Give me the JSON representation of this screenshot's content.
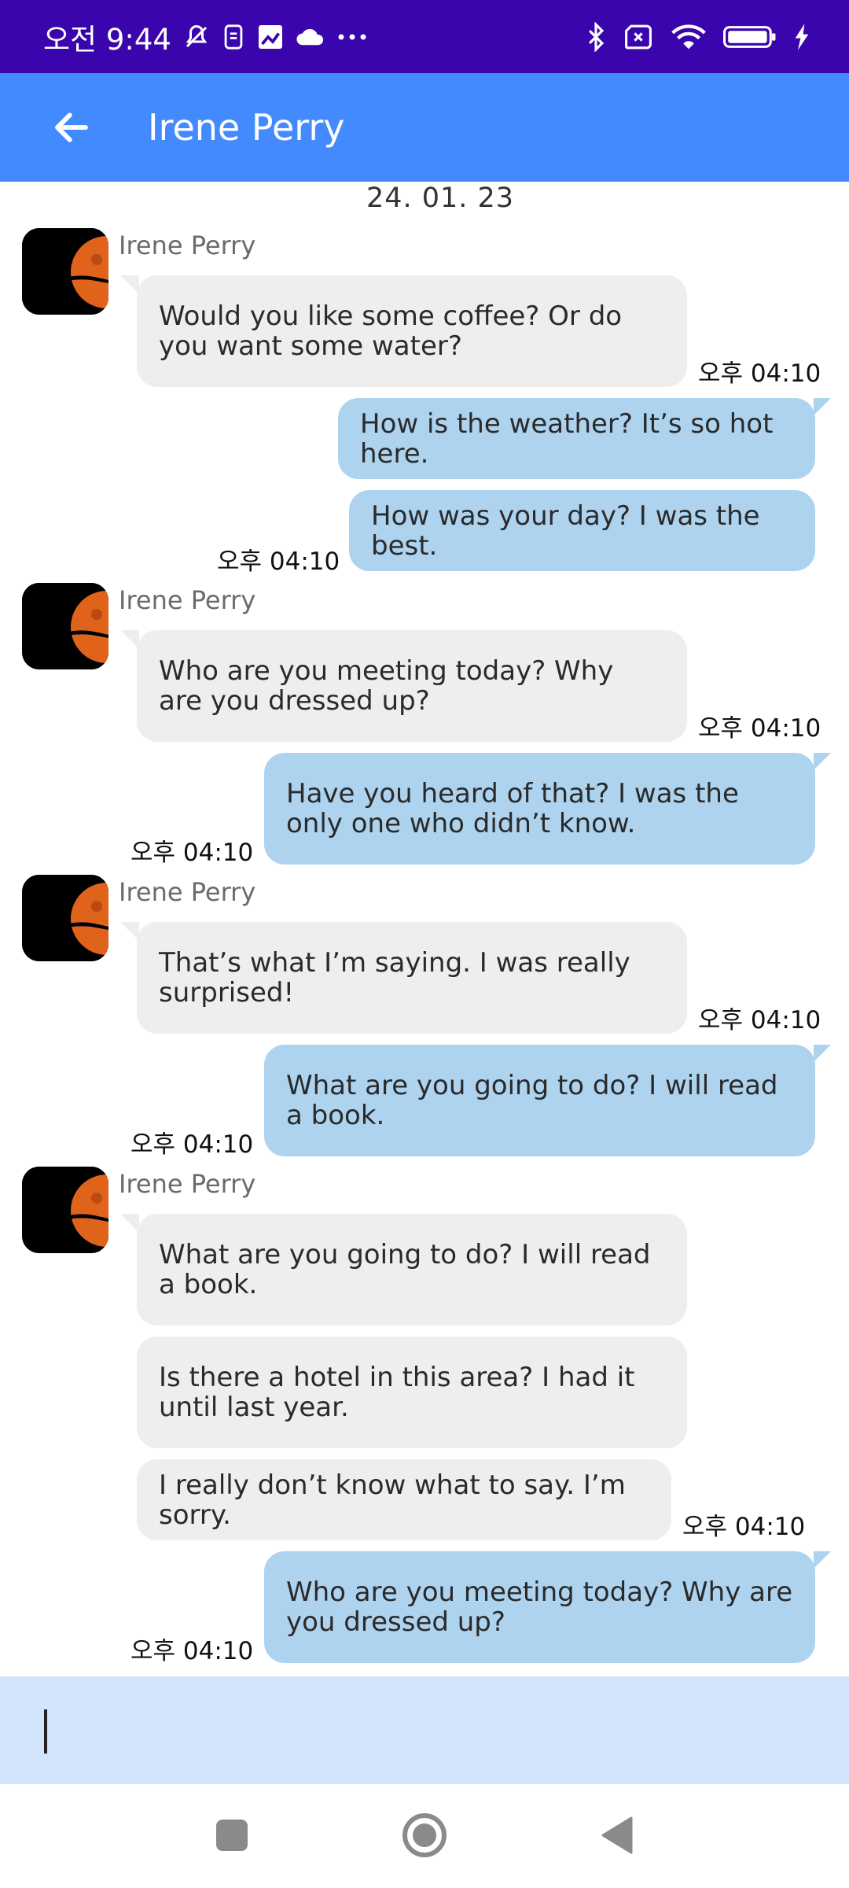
{
  "status_bar": {
    "time": "오전 9:44",
    "icons_left": [
      "mute-bell-icon",
      "sim-icon",
      "photo-icon",
      "cloud-icon",
      "more-dots-icon"
    ],
    "icons_right": [
      "bluetooth-icon",
      "no-sim-icon",
      "wifi-icon",
      "battery-icon",
      "charging-icon"
    ]
  },
  "app_bar": {
    "title": "Irene Perry",
    "back_icon": "arrow-back-icon",
    "background": "#448aff"
  },
  "date": "24. 01. 23",
  "messages": {
    "g1": {
      "sender": "Irene Perry",
      "m1": "Would you like some coffee? Or do you want some water?",
      "time": "오후 04:10"
    },
    "g2": {
      "m1": "How is the weather? It’s so hot here.",
      "m2": "How was your day? I was the best.",
      "time": "오후 04:10"
    },
    "g3": {
      "sender": "Irene Perry",
      "m1": "Who are you meeting today? Why are you dressed up?",
      "time": "오후 04:10"
    },
    "g4": {
      "m1": "Have you heard of that? I was the only one who didn’t know.",
      "time": "오후 04:10"
    },
    "g5": {
      "sender": "Irene Perry",
      "m1": "That’s what I’m saying. I was really surprised!",
      "time": "오후 04:10"
    },
    "g6": {
      "m1": "What are you going to do? I will read a book.",
      "time": "오후 04:10"
    },
    "g7": {
      "sender": "Irene Perry",
      "m1": "What are you going to do? I will read a book.",
      "m2": "Is there a hotel in this area? I had it until last year.",
      "m3": "I really don’t know what to say. I’m sorry.",
      "time": "오후 04:10"
    },
    "g8": {
      "m1": "Who are you meeting today? Why are you dressed up?",
      "time": "오후 04:10"
    }
  },
  "input": {
    "value": ""
  },
  "nav_bar": {
    "icons": [
      "recents-square-icon",
      "home-circle-icon",
      "back-triangle-icon"
    ]
  },
  "colors": {
    "status_bar": "#3a05ad",
    "incoming_bubble": "#eeeeee",
    "outgoing_bubble": "#aed3ef",
    "input_bar": "#d2e3fc"
  }
}
